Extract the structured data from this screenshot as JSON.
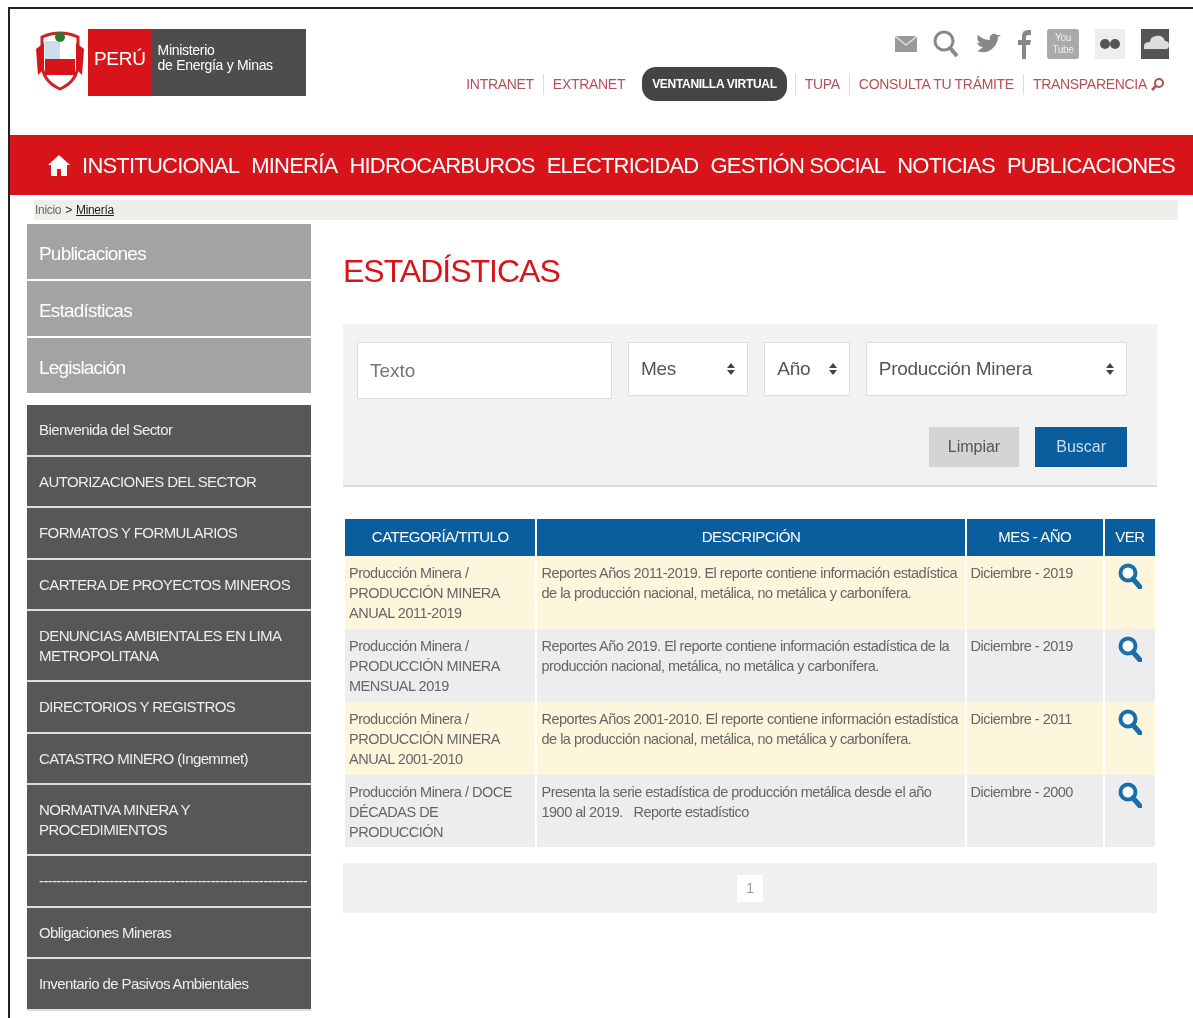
{
  "header": {
    "logo": {
      "country": "PERÚ",
      "ministry": [
        "Ministerio",
        "de Energía y Minas"
      ]
    },
    "social_icons": [
      {
        "kind": "mail"
      },
      {
        "kind": "search"
      },
      {
        "kind": "twitter"
      },
      {
        "kind": "facebook"
      },
      {
        "kind": "youtube",
        "label": [
          "You",
          "Tube"
        ]
      },
      {
        "kind": "flickr"
      },
      {
        "kind": "soundcloud"
      }
    ],
    "top_links": [
      {
        "label": "INTRANET",
        "kind": "link"
      },
      {
        "label": "EXTRANET",
        "kind": "link"
      },
      {
        "label": "VENTANILLA VIRTUAL",
        "kind": "pill"
      },
      {
        "label": "TUPA",
        "kind": "link"
      },
      {
        "label": "CONSULTA TU TRÁMITE",
        "kind": "link"
      },
      {
        "label": "TRANSPARENCIA",
        "kind": "search-link"
      }
    ]
  },
  "nav": {
    "items": [
      "INSTITUCIONAL",
      "MINERÍA",
      "HIDROCARBUROS",
      "ELECTRICIDAD",
      "GESTIÓN SOCIAL",
      "NOTICIAS",
      "PUBLICACIONES"
    ]
  },
  "breadcrumb": [
    {
      "label": "Inicio",
      "current": false
    },
    {
      "label": "Minería",
      "current": true
    }
  ],
  "breadcrumb_separator": ">",
  "sidebar": {
    "primary": [
      "Publicaciones",
      "Estadísticas",
      "Legislación"
    ],
    "secondary": [
      "Bienvenida del Sector",
      "AUTORIZACIONES DEL SECTOR",
      "FORMATOS Y FORMULARIOS",
      "CARTERA DE PROYECTOS MINEROS",
      "DENUNCIAS AMBIENTALES EN LIMA METROPOLITANA",
      "DIRECTORIOS Y REGISTROS",
      "CATASTRO MINERO (Ingemmet)",
      "NORMATIVA MINERA Y PROCEDIMIENTOS",
      {
        "label": "-------------------------------------------------------------",
        "kind": "separator"
      },
      "Obligaciones Mineras",
      "Inventario de Pasivos Ambientales"
    ]
  },
  "page_title": "ESTADÍSTICAS",
  "filters": {
    "text": {
      "placeholder": "Texto"
    },
    "selects": [
      {
        "value": "Mes"
      },
      {
        "value": "Año"
      },
      {
        "value": "Producción Minera"
      }
    ],
    "buttons": [
      {
        "label": "Limpiar",
        "kind": "secondary"
      },
      {
        "label": "Buscar",
        "kind": "primary"
      }
    ]
  },
  "table": {
    "columns": [
      "CATEGORÍA/TITULO",
      "DESCRIPCIÓN",
      "MES - AÑO",
      "VER"
    ],
    "rows": [
      {
        "category": "Producción Minera / PRODUCCIÓN MINERA ANUAL 2011-2019",
        "description": "Reportes Años 2011-2019. El reporte contiene información estadística de la producción nacional, metálica, no metálica y carbonífera.",
        "date": "Diciembre - 2019"
      },
      {
        "category": "Producción Minera / PRODUCCIÓN MINERA MENSUAL 2019",
        "description": "Reportes Año 2019. El reporte contiene información estadística de la producción nacional, metálica, no metálica y carbonífera.",
        "date": "Diciembre - 2019"
      },
      {
        "category": "Producción Minera / PRODUCCIÓN MINERA ANUAL 2001-2010",
        "description": "Reportes Años 2001-2010. El reporte contiene información estadística de la producción nacional, metálica, no metálica y carbonífera.",
        "date": "Diciembre - 2011"
      },
      {
        "category": "Producción Minera / DOCE DÉCADAS DE PRODUCCIÓN",
        "description": "Presenta la serie estadística de producción metálica desde el año 1900 al 2019.   Reporte estadístico",
        "date": "Diciembre - 2000"
      }
    ]
  },
  "pagination": [
    {
      "label": "1",
      "selected": true
    }
  ]
}
